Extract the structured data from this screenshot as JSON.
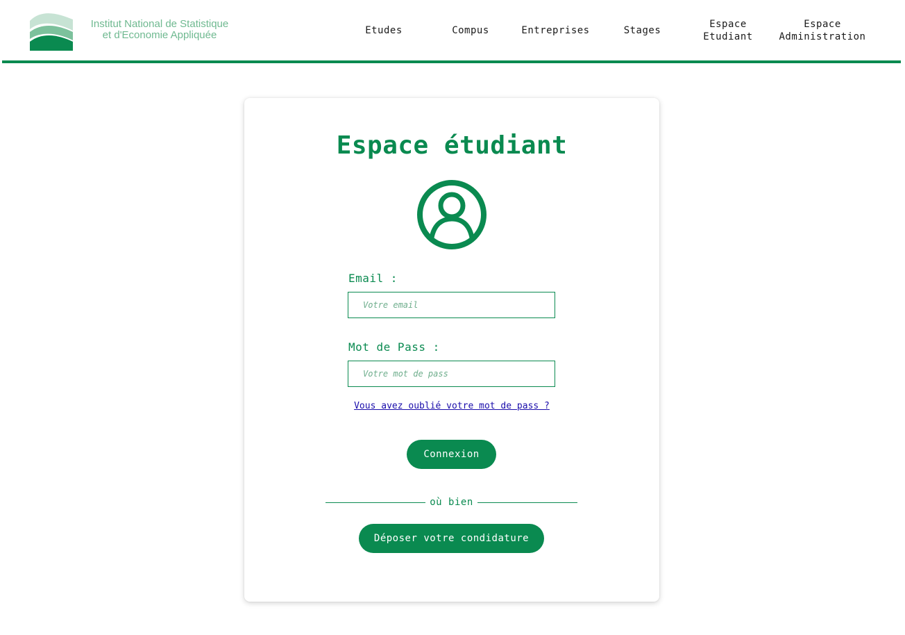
{
  "header": {
    "logo": {
      "line1": "Institut National de Statistique",
      "line2": "et d'Economie Appliquée"
    },
    "nav": [
      {
        "label": "Etudes"
      },
      {
        "label": "Compus"
      },
      {
        "label": "Entreprises"
      },
      {
        "label": "Stages"
      },
      {
        "label": "Espace\nEtudiant"
      },
      {
        "label": "Espace\nAdministration"
      }
    ]
  },
  "login": {
    "title": "Espace étudiant",
    "email_label": "Email :",
    "email_placeholder": "Votre email",
    "password_label": "Mot de Pass :",
    "password_placeholder": "Votre mot de pass",
    "forgot_link": "Vous avez oublié votre mot de pass ?",
    "submit_label": "Connexion",
    "divider_text": "où bien",
    "apply_label": "Déposer votre condidature"
  },
  "colors": {
    "accent": "#0a8a50",
    "logo_text": "#6fb990",
    "link": "#1a0dab"
  },
  "icons": {
    "avatar": "user-circle-icon",
    "logo": "waves-logo-icon"
  }
}
